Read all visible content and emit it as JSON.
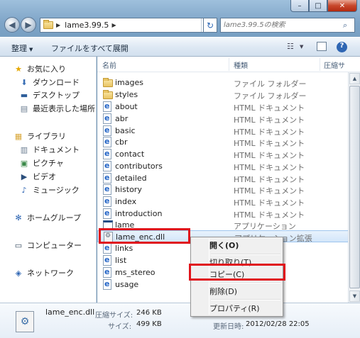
{
  "window": {
    "minimize": "–",
    "maximize": "□",
    "close": "✕"
  },
  "address": {
    "crumb": "lame3.99.5",
    "search_placeholder": "lame3.99.5の検索"
  },
  "toolbar": {
    "organize": "整理",
    "expand_all": "ファイルをすべて展開"
  },
  "sidebar": {
    "favorites": "お気に入り",
    "downloads": "ダウンロード",
    "desktop": "デスクトップ",
    "recent": "最近表示した場所",
    "libraries": "ライブラリ",
    "documents": "ドキュメント",
    "pictures": "ピクチャ",
    "videos": "ビデオ",
    "music": "ミュージック",
    "homegroup": "ホームグループ",
    "computer": "コンピューター",
    "network": "ネットワーク"
  },
  "columns": {
    "name": "名前",
    "type": "種類",
    "size": "圧縮サ"
  },
  "files": [
    {
      "name": "images",
      "type": "ファイル フォルダー",
      "icon": "folder-icon"
    },
    {
      "name": "styles",
      "type": "ファイル フォルダー",
      "icon": "folder-icon"
    },
    {
      "name": "about",
      "type": "HTML ドキュメント",
      "icon": "html-file-icon"
    },
    {
      "name": "abr",
      "type": "HTML ドキュメント",
      "icon": "html-file-icon"
    },
    {
      "name": "basic",
      "type": "HTML ドキュメント",
      "icon": "html-file-icon"
    },
    {
      "name": "cbr",
      "type": "HTML ドキュメント",
      "icon": "html-file-icon"
    },
    {
      "name": "contact",
      "type": "HTML ドキュメント",
      "icon": "html-file-icon"
    },
    {
      "name": "contributors",
      "type": "HTML ドキュメント",
      "icon": "html-file-icon"
    },
    {
      "name": "detailed",
      "type": "HTML ドキュメント",
      "icon": "html-file-icon"
    },
    {
      "name": "history",
      "type": "HTML ドキュメント",
      "icon": "html-file-icon"
    },
    {
      "name": "index",
      "type": "HTML ドキュメント",
      "icon": "html-file-icon"
    },
    {
      "name": "introduction",
      "type": "HTML ドキュメント",
      "icon": "html-file-icon"
    },
    {
      "name": "lame",
      "type": "アプリケーション",
      "icon": "app-icon"
    },
    {
      "name": "lame_enc.dll",
      "type": "アプリケーション拡張",
      "icon": "dll-icon"
    },
    {
      "name": "links",
      "type": "",
      "icon": "html-file-icon"
    },
    {
      "name": "list",
      "type": "",
      "icon": "html-file-icon"
    },
    {
      "name": "ms_stereo",
      "type": "",
      "icon": "html-file-icon"
    },
    {
      "name": "usage",
      "type": "",
      "icon": "html-file-icon"
    }
  ],
  "context_menu": {
    "open": "開く(O)",
    "cut": "切り取り(T)",
    "copy": "コピー(C)",
    "delete": "削除(D)",
    "properties": "プロパティ(R)"
  },
  "details": {
    "filename": "lame_enc.dll",
    "compressed_label": "圧縮サイズ:",
    "compressed_value": "246 KB",
    "size_label": "サイズ:",
    "size_value": "499 KB",
    "modified_label": "更新日時:",
    "modified_value": "2012/02/28 22:05"
  },
  "colors": {
    "highlight_box": "#e0141c",
    "selection": "#d3e6fa"
  }
}
